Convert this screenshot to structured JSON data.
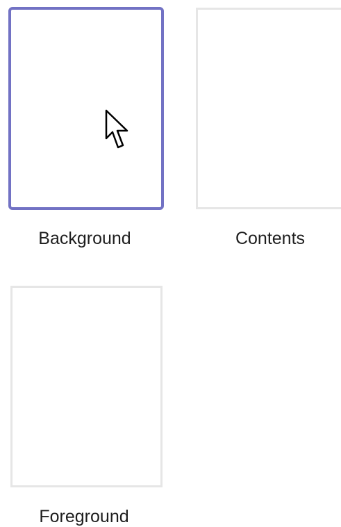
{
  "layouts": [
    {
      "id": "background",
      "label": "Background",
      "selected": true
    },
    {
      "id": "contents",
      "label": "Contents",
      "selected": false
    },
    {
      "id": "foreground",
      "label": "Foreground",
      "selected": false
    }
  ],
  "colors": {
    "selection_border": "#7272c4",
    "thumbnail_border": "#e6e6e6",
    "label_text": "#1e1e1e"
  },
  "cursor": {
    "icon": "arrow-cursor-icon"
  }
}
